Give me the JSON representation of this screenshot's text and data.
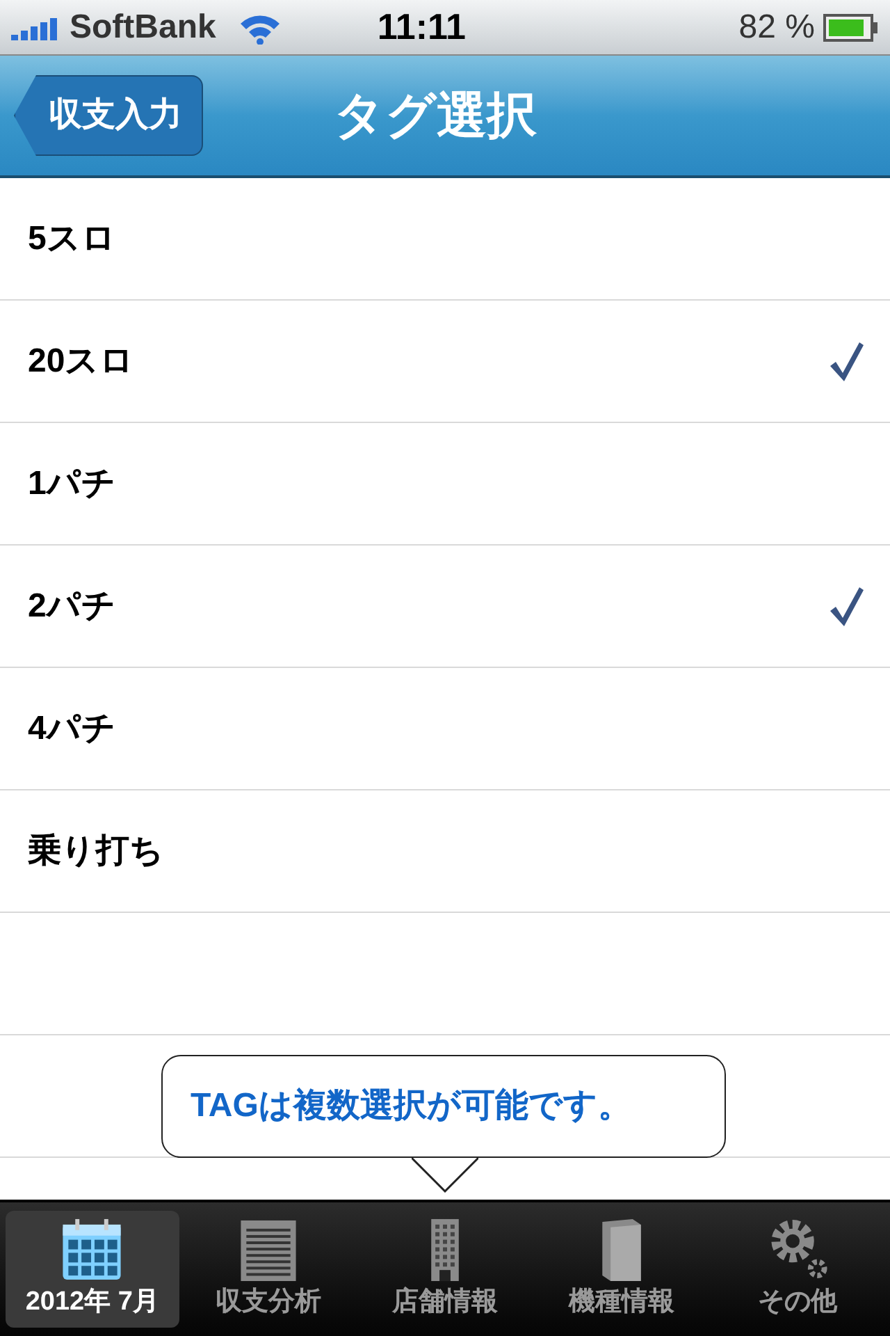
{
  "status_bar": {
    "carrier": "SoftBank",
    "time": "11:11",
    "battery": "82 %"
  },
  "nav_bar": {
    "back_button": "収支入力",
    "title": "タグ選択"
  },
  "tags": [
    {
      "label": "5スロ",
      "checked": false
    },
    {
      "label": "20スロ",
      "checked": true
    },
    {
      "label": "1パチ",
      "checked": false
    },
    {
      "label": "2パチ",
      "checked": true
    },
    {
      "label": "4パチ",
      "checked": false
    },
    {
      "label": "乗り打ち",
      "checked": false
    }
  ],
  "tooltip": "TAGは複数選択が可能です。",
  "tab_bar": [
    {
      "label": "2012年 7月",
      "kind": "calendar",
      "selected": true
    },
    {
      "label": "収支分析",
      "kind": "notepad",
      "selected": false
    },
    {
      "label": "店舗情報",
      "kind": "building",
      "selected": false
    },
    {
      "label": "機種情報",
      "kind": "book",
      "selected": false
    },
    {
      "label": "その他",
      "kind": "gears",
      "selected": false
    }
  ]
}
